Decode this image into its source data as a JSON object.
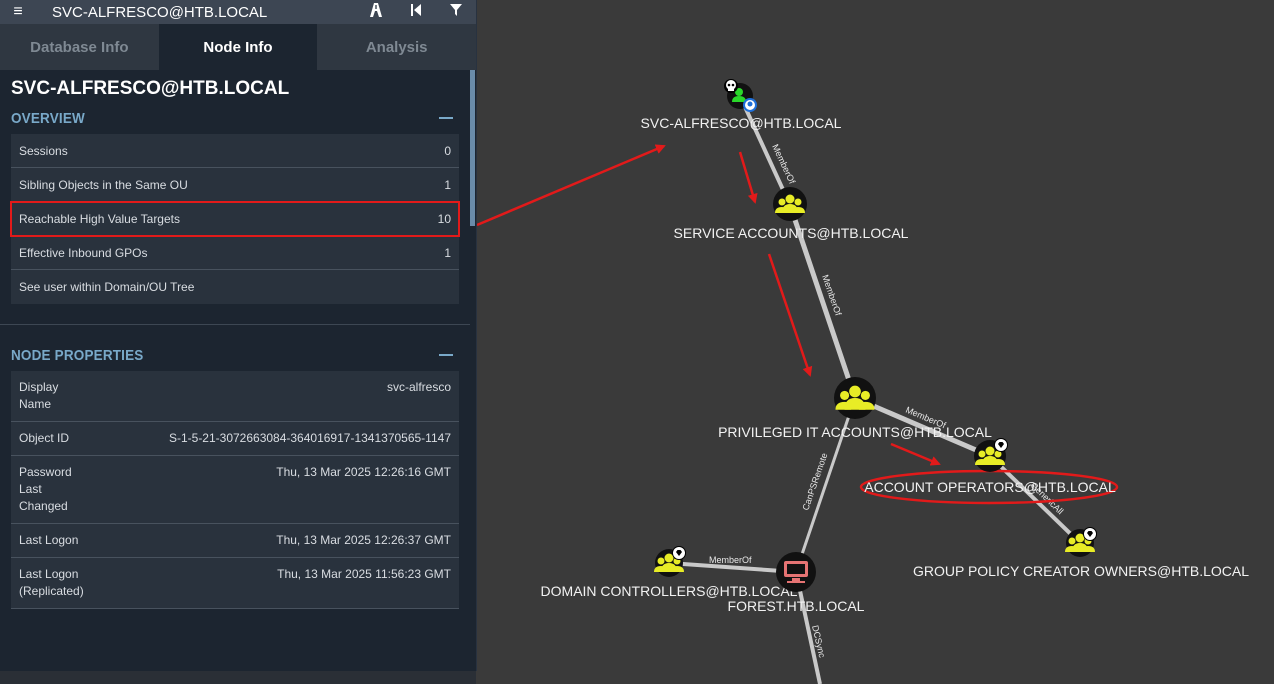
{
  "topbar": {
    "menu_icon": "≡",
    "title": "SVC-ALFRESCO@HTB.LOCAL"
  },
  "tabs": [
    {
      "label": "Database Info",
      "active": false
    },
    {
      "label": "Node Info",
      "active": true
    },
    {
      "label": "Analysis",
      "active": false
    }
  ],
  "node": {
    "title": "SVC-ALFRESCO@HTB.LOCAL"
  },
  "overview": {
    "label": "OVERVIEW",
    "rows": [
      {
        "label": "Sessions",
        "value": "0"
      },
      {
        "label": "Sibling Objects in the Same OU",
        "value": "1"
      },
      {
        "label": "Reachable High Value Targets",
        "value": "10"
      },
      {
        "label": "Effective Inbound GPOs",
        "value": "1"
      },
      {
        "label": "See user within Domain/OU Tree",
        "value": ""
      }
    ]
  },
  "properties": {
    "label": "NODE PROPERTIES",
    "rows": [
      {
        "label": "Display Name",
        "value": "svc-alfresco"
      },
      {
        "label": "Object ID",
        "value": "S-1-5-21-3072663084-364016917-1341370565-1147"
      },
      {
        "label": "Password Last Changed",
        "value": "Thu, 13 Mar 2025 12:26:16 GMT"
      },
      {
        "label": "Last Logon",
        "value": "Thu, 13 Mar 2025 12:26:37 GMT"
      },
      {
        "label": "Last Logon (Replicated)",
        "value": "Thu, 13 Mar 2025 11:56:23 GMT"
      }
    ]
  },
  "graph": {
    "nodes": {
      "svc_alfresco": "SVC-ALFRESCO@HTB.LOCAL",
      "service_accounts": "SERVICE ACCOUNTS@HTB.LOCAL",
      "privileged_it": "PRIVILEGED IT ACCOUNTS@HTB.LOCAL",
      "account_operators": "ACCOUNT OPERATORS@HTB.LOCAL",
      "gpo_creator_owners": "GROUP POLICY CREATOR OWNERS@HTB.LOCAL",
      "domain_controllers": "DOMAIN CONTROLLERS@HTB.LOCAL",
      "forest": "FOREST.HTB.LOCAL"
    },
    "edges": {
      "e1": "MemberOf",
      "e2": "MemberOf",
      "e3": "MemberOf",
      "e4": "CanPSRemote",
      "e5": "GenericAll",
      "e6": "MemberOf",
      "e7": "DCSync"
    }
  },
  "colors": {
    "background": "#3a3a3a",
    "panel": "#1c2530",
    "section_accent": "#79a9c9",
    "group_icon": "#e8ec26",
    "computer_icon": "#e57373",
    "annotation_red": "#e21a1a"
  },
  "icons": [
    "menu-icon",
    "path-finding-icon",
    "back-icon",
    "filter-icon",
    "collapse-icon",
    "group-icon",
    "user-icon",
    "computer-icon",
    "skull-icon",
    "high-value-icon",
    "owned-icon"
  ]
}
